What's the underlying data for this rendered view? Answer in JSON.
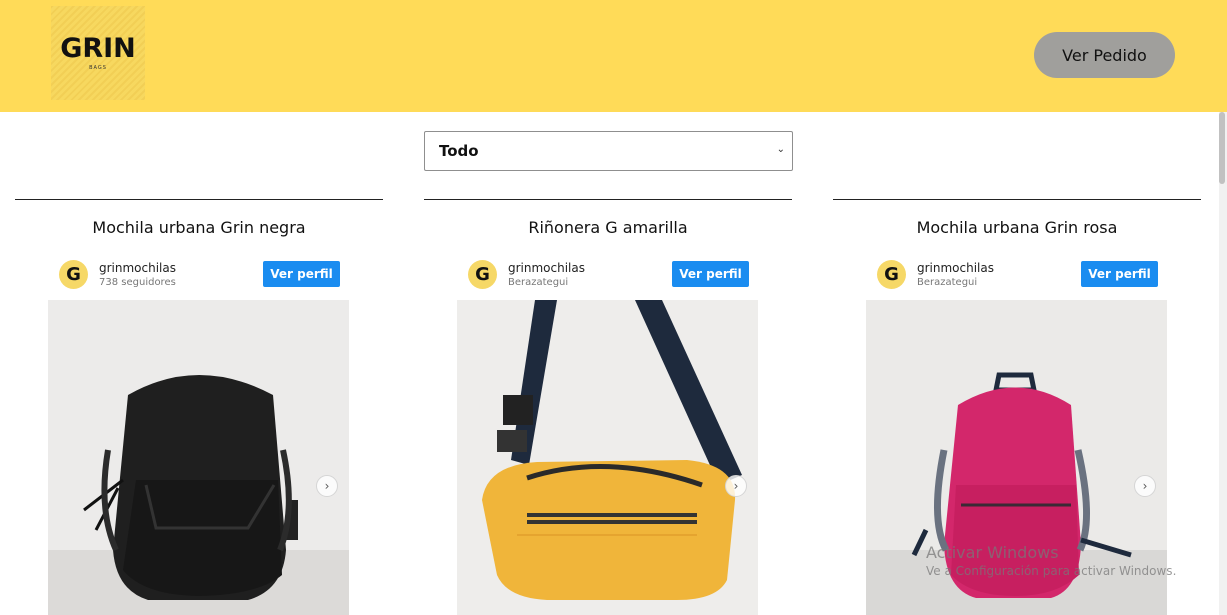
{
  "header": {
    "logo_text": "GRIN",
    "logo_subtext": "BAGS",
    "order_button_label": "Ver Pedido"
  },
  "filter": {
    "selected": "Todo"
  },
  "products": [
    {
      "title": "Mochila urbana Grin negra",
      "username": "grinmochilas",
      "subline": "738 seguidores",
      "profile_button": "Ver perfil",
      "avatar_letter": "G",
      "color": "#1d1d1d"
    },
    {
      "title": "Riñonera G amarilla",
      "username": "grinmochilas",
      "subline": "Berazategui",
      "profile_button": "Ver perfil",
      "avatar_letter": "G",
      "color": "#f0b53a"
    },
    {
      "title": "Mochila urbana Grin rosa",
      "username": "grinmochilas",
      "subline": "Berazategui",
      "profile_button": "Ver perfil",
      "avatar_letter": "G",
      "color": "#d3276b"
    }
  ],
  "watermark": {
    "line1": "Activar Windows",
    "line2": "Ve a Configuración para activar Windows."
  },
  "colors": {
    "header_bg": "#ffdb58",
    "profile_button_bg": "#1a8cf0",
    "order_button_bg": "#a09f9c"
  },
  "icons": {
    "select_chevron": "chevron-down-icon",
    "carousel_next": "chevron-right-icon"
  }
}
